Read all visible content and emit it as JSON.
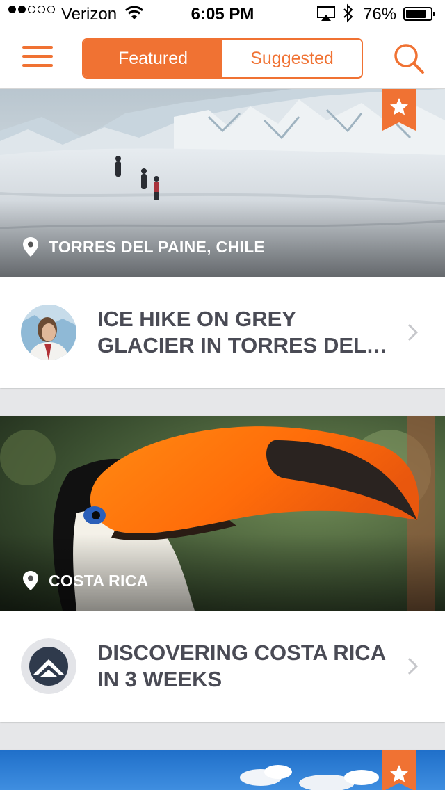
{
  "status": {
    "carrier": "Verizon",
    "time": "6:05 PM",
    "battery": "76%"
  },
  "nav": {
    "tabs": [
      "Featured",
      "Suggested"
    ],
    "active_tab": "Featured"
  },
  "cards": [
    {
      "location": "TORRES DEL PAINE, CHILE",
      "title": "ICE HIKE ON GREY GLACIER IN TORRES DEL PAINE",
      "starred": true
    },
    {
      "location": "COSTA RICA",
      "title": "DISCOVERING COSTA RICA IN 3 WEEKS",
      "starred": false
    },
    {
      "starred": true
    }
  ],
  "colors": {
    "accent": "#f07233",
    "title_text": "#4a4b55",
    "background": "#e6e7e9"
  }
}
